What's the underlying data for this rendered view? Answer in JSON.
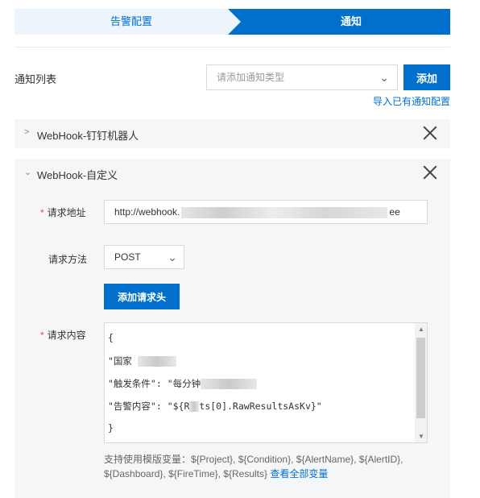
{
  "steps": [
    {
      "label": "告警配置",
      "active": false
    },
    {
      "label": "通知",
      "active": true
    }
  ],
  "notify_list": {
    "label": "通知列表",
    "type_select_placeholder": "请添加通知类型",
    "add_button": "添加",
    "import_link": "导入已有通知配置"
  },
  "panels": [
    {
      "title": "WebHook-钉钉机器人",
      "expanded": false
    },
    {
      "title": "WebHook-自定义",
      "expanded": true
    }
  ],
  "form": {
    "url_label": "请求地址",
    "url_value_prefix": "http://webhook.",
    "url_value_suffix": "ee",
    "method_label": "请求方法",
    "method_value": "POST",
    "add_header_button": "添加请求头",
    "body_label": "请求内容",
    "body_lines": [
      "{",
      "\"国家",
      "\"触发条件\": \"每分钟",
      "\"告警内容\": \"${R",
      "ts[0].RawResultsAsKv}\"",
      "}"
    ],
    "help_text": "支持使用模版变量：${Project}, ${Condition}, ${AlertName}, ${AlertID}, ${Dashboard}, ${FireTime}, ${Results}",
    "help_link": "查看全部变量"
  }
}
